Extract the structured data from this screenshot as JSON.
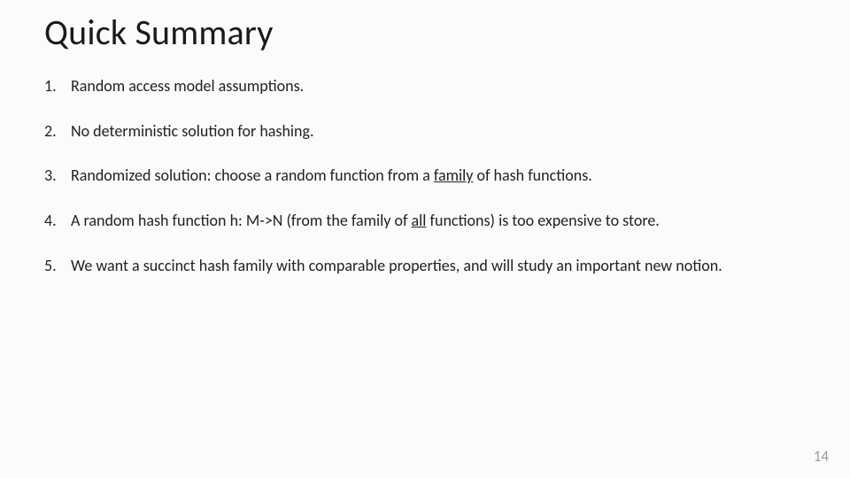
{
  "title": "Quick Summary",
  "items": [
    {
      "num": "1.",
      "plain": "Random access model assumptions."
    },
    {
      "num": "2.",
      "plain": "No deterministic solution for hashing."
    },
    {
      "num": "3.",
      "pre": "Randomized solution: choose a random function from a ",
      "u": "family",
      "post": " of hash functions."
    },
    {
      "num": "4.",
      "pre": "A random hash function h: M->N (from the family of ",
      "u": "all",
      "post": " functions) is too expensive to store."
    },
    {
      "num": "5.",
      "plain": "We want a succinct hash family with comparable properties, and will study an important new notion."
    }
  ],
  "page_number": "14"
}
